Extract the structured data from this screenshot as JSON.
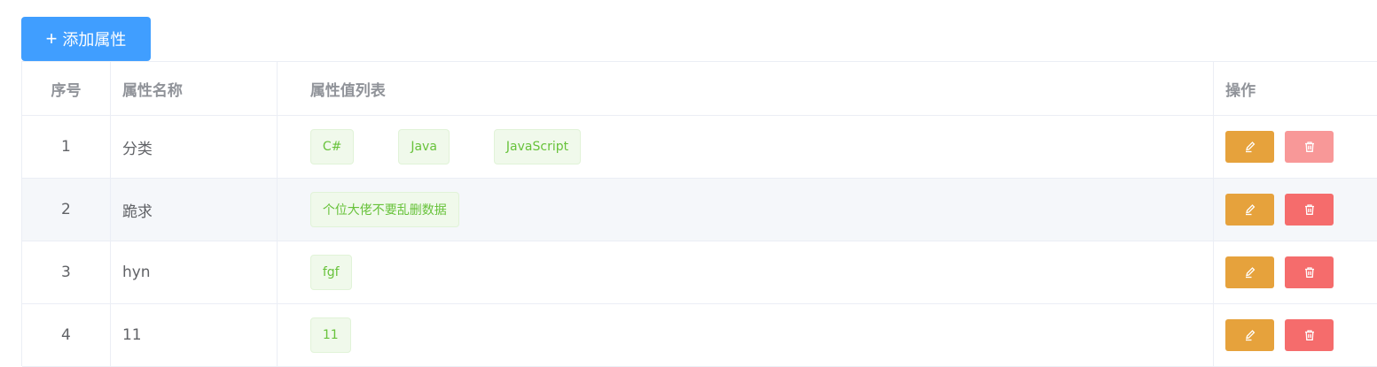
{
  "toolbar": {
    "add_label": "添加属性",
    "add_icon": "plus-icon"
  },
  "table": {
    "headers": {
      "index": "序号",
      "name": "属性名称",
      "values": "属性值列表",
      "ops": "操作"
    },
    "rows": [
      {
        "index": "1",
        "name": "分类",
        "values": [
          "C#",
          "Java",
          "JavaScript"
        ]
      },
      {
        "index": "2",
        "name": "跪求",
        "values": [
          "个位大佬不要乱删数据"
        ]
      },
      {
        "index": "3",
        "name": "hyn",
        "values": [
          "fgf"
        ]
      },
      {
        "index": "4",
        "name": "11",
        "values": [
          "11"
        ]
      }
    ]
  },
  "icons": {
    "edit": "edit-icon",
    "delete": "delete-icon"
  },
  "colors": {
    "primary": "#409eff",
    "warning": "#e6a23c",
    "danger": "#f56c6c",
    "success": "#67c23a"
  }
}
